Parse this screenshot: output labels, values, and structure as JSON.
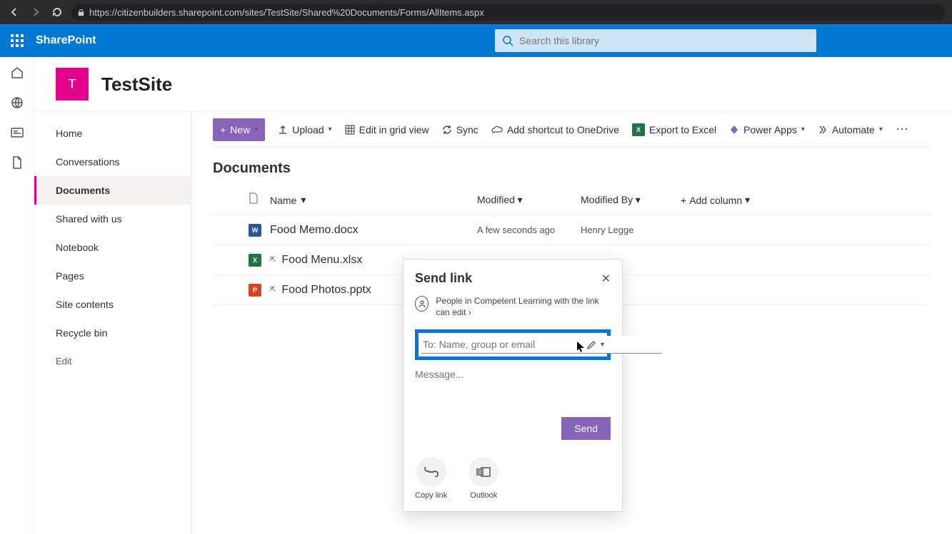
{
  "browser": {
    "url": "https://citizenbuilders.sharepoint.com/sites/TestSite/Shared%20Documents/Forms/AllItems.aspx"
  },
  "header": {
    "brand": "SharePoint",
    "search_placeholder": "Search this library"
  },
  "site": {
    "logo_letter": "T",
    "title": "TestSite"
  },
  "nav": {
    "items": [
      "Home",
      "Conversations",
      "Documents",
      "Shared with us",
      "Notebook",
      "Pages",
      "Site contents",
      "Recycle bin"
    ],
    "edit": "Edit",
    "active_index": 2
  },
  "cmdbar": {
    "new": "New",
    "upload": "Upload",
    "edit_grid": "Edit in grid view",
    "sync": "Sync",
    "shortcut": "Add shortcut to OneDrive",
    "export": "Export to Excel",
    "powerapps": "Power Apps",
    "automate": "Automate"
  },
  "page_title": "Documents",
  "columns": {
    "name": "Name",
    "modified": "Modified",
    "modified_by": "Modified By",
    "add": "Add column"
  },
  "files": [
    {
      "icon": "word",
      "label": "W",
      "name": "Food Memo.docx",
      "shared": false,
      "modified": "A few seconds ago",
      "by": "Henry Legge"
    },
    {
      "icon": "excel",
      "label": "X",
      "name": "Food Menu.xlsx",
      "shared": true,
      "modified": "",
      "by": ""
    },
    {
      "icon": "ppt",
      "label": "P",
      "name": "Food Photos.pptx",
      "shared": true,
      "modified": "",
      "by": ""
    }
  ],
  "dialog": {
    "title": "Send link",
    "scope": "People in Competent Learning with the link can edit",
    "to_placeholder": "To: Name, group or email",
    "message_placeholder": "Message...",
    "send": "Send",
    "copy": "Copy link",
    "outlook": "Outlook"
  }
}
